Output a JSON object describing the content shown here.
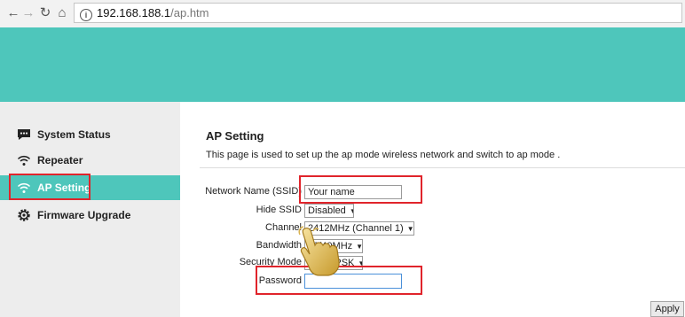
{
  "browser": {
    "url_host": "192.168.188.1",
    "url_path": "/ap.htm"
  },
  "sidebar": {
    "items": [
      {
        "label": "System Status",
        "icon": "chat-icon"
      },
      {
        "label": "Repeater",
        "icon": "wifi-icon"
      },
      {
        "label": "AP Setting",
        "icon": "wifi-icon",
        "active": true
      },
      {
        "label": "Firmware Upgrade",
        "icon": "gear-icon"
      }
    ]
  },
  "main": {
    "title": "AP Setting",
    "description": "This page is used to set up the ap mode wireless network and switch to ap mode .",
    "form": {
      "ssid_label": "Network Name (SSID)",
      "ssid_value": "Your name",
      "hide_ssid_label": "Hide SSID",
      "hide_ssid_value": "Disabled",
      "channel_label": "Channel",
      "channel_value": "2412MHz (Channel 1)",
      "bandwidth_label": "Bandwidth",
      "bandwidth_value": "20/40MHz",
      "security_label": "Security Mode",
      "security_value": "WPA2PSK",
      "password_label": "Password",
      "password_value": ""
    },
    "apply_label": "Apply"
  },
  "colors": {
    "accent": "#4ec6bb",
    "highlight": "#e0242b",
    "sidebar_bg": "#ededed"
  }
}
